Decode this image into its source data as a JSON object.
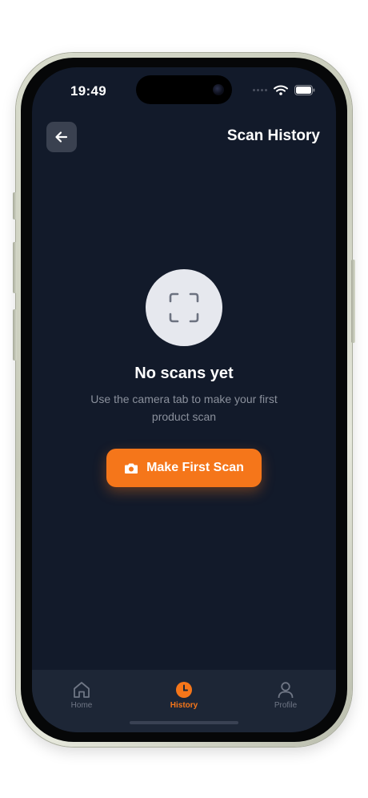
{
  "status_bar": {
    "time": "19:49",
    "icons": [
      "signal-dots-icon",
      "wifi-icon",
      "battery-icon"
    ]
  },
  "header": {
    "back_icon": "arrow-left-icon",
    "title": "Scan History"
  },
  "empty_state": {
    "icon": "scan-frame-icon",
    "title": "No scans yet",
    "subtitle": "Use the camera tab to make your first product scan",
    "button_icon": "camera-icon",
    "button_label": "Make First Scan"
  },
  "tab_bar": {
    "tabs": [
      {
        "label": "Home",
        "icon": "home-icon",
        "active": false
      },
      {
        "label": "History",
        "icon": "clock-icon",
        "active": true
      },
      {
        "label": "Profile",
        "icon": "user-icon",
        "active": false
      }
    ]
  },
  "colors": {
    "screen_background": "#121a2a",
    "accent": "#f5761a",
    "tab_bar": "#1d2636",
    "muted_text": "#8a909c"
  }
}
